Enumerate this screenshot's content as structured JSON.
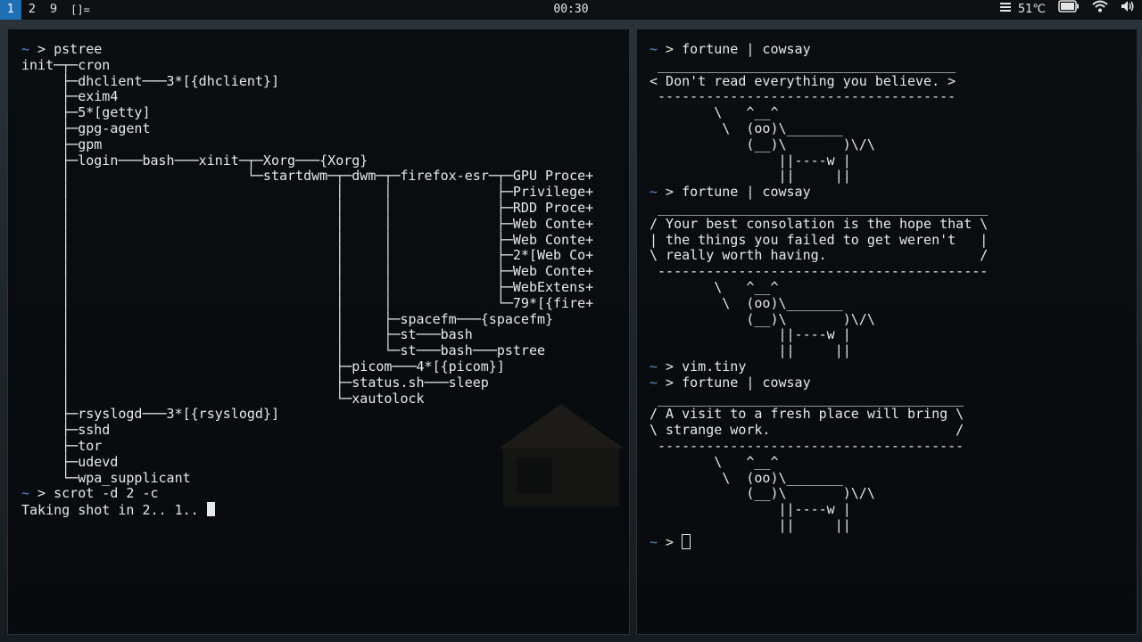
{
  "bar": {
    "tags": [
      "1",
      "2",
      "9"
    ],
    "active_tag": "1",
    "layout": "[]=",
    "clock": "00:30",
    "temperature": "51℃",
    "icons": [
      "cpu-icon",
      "battery-icon",
      "wifi-icon",
      "volume-icon"
    ]
  },
  "left_terminal": {
    "lines": [
      "~ > pstree",
      "init─┬─cron",
      "     ├─dhclient───3*[{dhclient}]",
      "     ├─exim4",
      "     ├─5*[getty]",
      "     ├─gpg-agent",
      "     ├─gpm",
      "     ├─login───bash───xinit─┬─Xorg───{Xorg}",
      "     │                      └─startdwm─┬─dwm─┬─firefox-esr─┬─GPU Proce+",
      "     │                                 │     │             ├─Privilege+",
      "     │                                 │     │             ├─RDD Proce+",
      "     │                                 │     │             ├─Web Conte+",
      "     │                                 │     │             ├─Web Conte+",
      "     │                                 │     │             ├─2*[Web Co+",
      "     │                                 │     │             ├─Web Conte+",
      "     │                                 │     │             ├─WebExtens+",
      "     │                                 │     │             └─79*[{fire+",
      "     │                                 │     ├─spacefm───{spacefm}",
      "     │                                 │     ├─st───bash",
      "     │                                 │     └─st───bash───pstree",
      "     │                                 ├─picom───4*[{picom}]",
      "     │                                 ├─status.sh───sleep",
      "     │                                 └─xautolock",
      "     ├─rsyslogd───3*[{rsyslogd}]",
      "     ├─sshd",
      "     ├─tor",
      "     ├─udevd",
      "     └─wpa_supplicant",
      "~ > scrot -d 2 -c",
      "Taking shot in 2.. 1.. "
    ]
  },
  "right_terminal": {
    "lines": [
      "~ > fortune | cowsay",
      " _____________________________________",
      "< Don't read everything you believe. >",
      " -------------------------------------",
      "        \\   ^__^",
      "         \\  (oo)\\_______",
      "            (__)\\       )\\/\\",
      "                ||----w |",
      "                ||     ||",
      "~ > fortune | cowsay",
      " _________________________________________",
      "/ Your best consolation is the hope that \\",
      "| the things you failed to get weren't   |",
      "\\ really worth having.                   /",
      " -----------------------------------------",
      "        \\   ^__^",
      "         \\  (oo)\\_______",
      "            (__)\\       )\\/\\",
      "                ||----w |",
      "                ||     ||",
      "~ > vim.tiny",
      "~ > fortune | cowsay",
      " ______________________________________",
      "/ A visit to a fresh place will bring \\",
      "\\ strange work.                       /",
      " --------------------------------------",
      "        \\   ^__^",
      "         \\  (oo)\\_______",
      "            (__)\\       )\\/\\",
      "                ||----w |",
      "                ||     ||",
      "~ > "
    ]
  }
}
